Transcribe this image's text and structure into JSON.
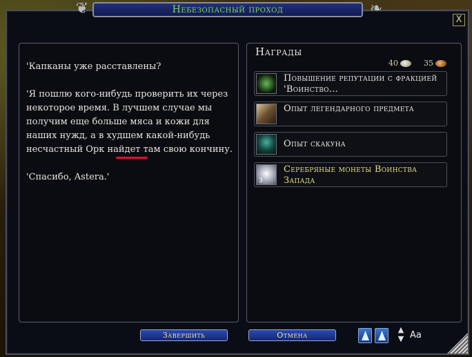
{
  "window": {
    "title": "Небезопасный проход",
    "close_label": "X"
  },
  "quest": {
    "paragraphs": [
      "'Капканы уже расставлены?",
      "'Я пошлю кого-нибудь проверить их через некоторое время. В лучшем случае мы получим еще больше мяса и кожи для наших нужд, а в худшем какой-нибудь несчастный Орк найдет там свою кончину.",
      "'Спасибо, Astera.'"
    ]
  },
  "rewards": {
    "title": "Награды",
    "currency": [
      {
        "amount": "40",
        "type": "silver"
      },
      {
        "amount": "35",
        "type": "copper"
      }
    ],
    "items": [
      {
        "label": "Повышение репутации с фракцией 'Воинство...",
        "icon": "reputation-icon",
        "highlight": false
      },
      {
        "label": "Опыт легендарного предмета",
        "icon": "legendary-item-icon",
        "highlight": false
      },
      {
        "label": "Опыт скакуна",
        "icon": "horse-icon",
        "highlight": false
      },
      {
        "label": "Серебряные монеты Воинства Запада",
        "icon": "silver-coins-icon",
        "highlight": true,
        "count": "3"
      }
    ]
  },
  "buttons": {
    "complete": "Завершить",
    "cancel": "Отмена"
  },
  "toolbar": {
    "font_label": "Aa",
    "up_arrow": "▲",
    "down_arrow": "▼"
  }
}
